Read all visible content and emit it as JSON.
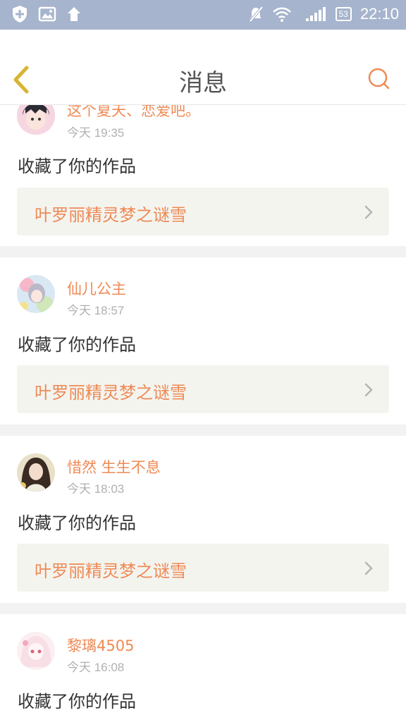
{
  "status_bar": {
    "time": "22:10",
    "battery": "53",
    "icons": [
      "shield-icon",
      "image-icon",
      "upload-arrow-icon",
      "mute-icon",
      "wifi-icon",
      "signal-icon",
      "battery-icon"
    ]
  },
  "header": {
    "title": "消息",
    "back_icon": "chevron-left-icon",
    "search_icon": "search-icon"
  },
  "colors": {
    "accent": "#ee8a55",
    "back_icon": "#d8b530",
    "status_bar": "#a6b4cd",
    "link_bg": "#f4f4ef",
    "divider": "#f2f2f2"
  },
  "messages": [
    {
      "username": "这个夏天、恋爱吧。",
      "time": "今天 19:35",
      "action": "收藏了你的作品",
      "work": "叶罗丽精灵梦之谜雪"
    },
    {
      "username": "仙儿公主",
      "time": "今天 18:57",
      "action": "收藏了你的作品",
      "work": "叶罗丽精灵梦之谜雪"
    },
    {
      "username": "惜然 生生不息",
      "time": "今天 18:03",
      "action": "收藏了你的作品",
      "work": "叶罗丽精灵梦之谜雪"
    },
    {
      "username": "黎璃4505",
      "time": "今天 16:08",
      "action": "收藏了你的作品"
    }
  ]
}
